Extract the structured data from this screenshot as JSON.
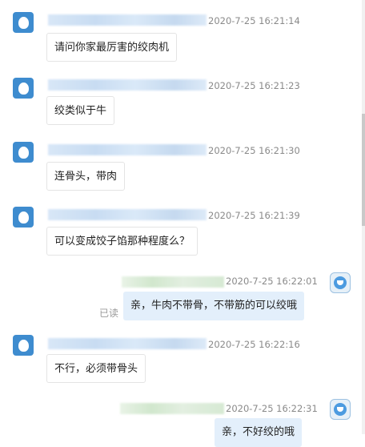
{
  "messages": [
    {
      "side": "in",
      "time": "2020-7-25 16:21:14",
      "text": "请问你家最厉害的绞肉机"
    },
    {
      "side": "in",
      "time": "2020-7-25 16:21:23",
      "text": "绞类似于牛"
    },
    {
      "side": "in",
      "time": "2020-7-25 16:21:30",
      "text": "连骨头，带肉"
    },
    {
      "side": "in",
      "time": "2020-7-25 16:21:39",
      "text": "可以变成饺子馅那种程度么？"
    },
    {
      "side": "out",
      "time": "2020-7-25 16:22:01",
      "text": "亲，牛肉不带骨，不带筋的可以绞哦",
      "read": "已读"
    },
    {
      "side": "in",
      "time": "2020-7-25 16:22:16",
      "text": "不行，必须带骨头"
    },
    {
      "side": "out",
      "time": "2020-7-25 16:22:31",
      "text": "亲，不好绞的哦"
    }
  ],
  "icons": {
    "customer_avatar": "user-avatar-icon",
    "agent_avatar": "agent-avatar-icon"
  },
  "colors": {
    "avatar_blue": "#3e8ccf",
    "outgoing_bubble": "#e3effb",
    "timestamp": "#8a8a8a"
  }
}
